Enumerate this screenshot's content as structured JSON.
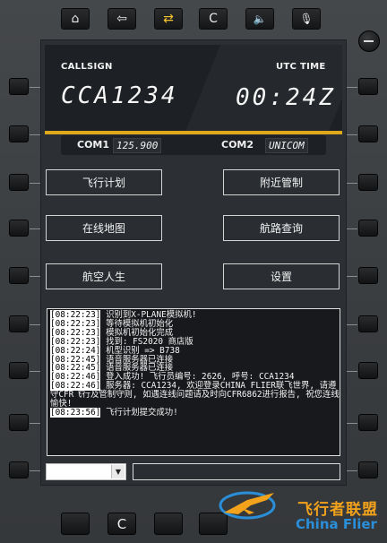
{
  "toolbar": {
    "buttons": [
      {
        "icon": "home-icon",
        "glyph": "⌂"
      },
      {
        "icon": "back-arrow-icon",
        "glyph": "⇦"
      },
      {
        "icon": "swap-icon",
        "glyph": "⇄"
      },
      {
        "icon": "clear-icon",
        "glyph": "C"
      },
      {
        "icon": "speaker-icon",
        "glyph": "🔈"
      },
      {
        "icon": "microphone-icon",
        "glyph": "🎙"
      }
    ]
  },
  "header": {
    "callsign_label": "CALLSIGN",
    "callsign_value": "CCA1234",
    "utc_label": "UTC TIME",
    "utc_value": "00:24Z"
  },
  "com": {
    "com1_label": "COM1",
    "com1_value": "125.900",
    "com2_label": "COM2",
    "com2_value": "UNICOM"
  },
  "menu": {
    "flight_plan": "飞行计划",
    "approach_control": "附近管制",
    "online_map": "在线地图",
    "route_query": "航路查询",
    "aviation_life": "航空人生",
    "settings": "设置"
  },
  "log": [
    {
      "ts": "[08:22:23]",
      "msg": " 识别到X-PLANE模拟机!"
    },
    {
      "ts": "[08:22:23]",
      "msg": " 等待模拟机初始化"
    },
    {
      "ts": "[08:22:23]",
      "msg": " 模拟机初始化完成"
    },
    {
      "ts": "[08:22:23]",
      "msg": " 找到: FS2020 商店版"
    },
    {
      "ts": "[08:22:24]",
      "msg": " 机型识别 => B738"
    },
    {
      "ts": "[08:22:45]",
      "msg": " 语音服务器已连接"
    },
    {
      "ts": "[08:22:45]",
      "msg": " 语音服务器已连接"
    },
    {
      "ts": "[08:22:46]",
      "msg": " 登入成功! 飞行员编号: 2626, 呼号: CCA1234"
    },
    {
      "ts": "[08:22:46]",
      "msg": " 服务器: CCA1234, 欢迎登录CHINA FLIER联飞世界, 请遵守CFR飞行及管制守则, 如遇连线问题请及时向CFR6862进行报告, 祝您连线愉快!"
    },
    {
      "ts": "[08:23:56]",
      "msg": " 飞行计划提交成功!"
    }
  ],
  "input": {
    "select_value": "",
    "text_value": ""
  },
  "bottom": {
    "clear_label": "C"
  },
  "watermark": {
    "cn": "飞行者联盟",
    "en": "China Flier"
  }
}
